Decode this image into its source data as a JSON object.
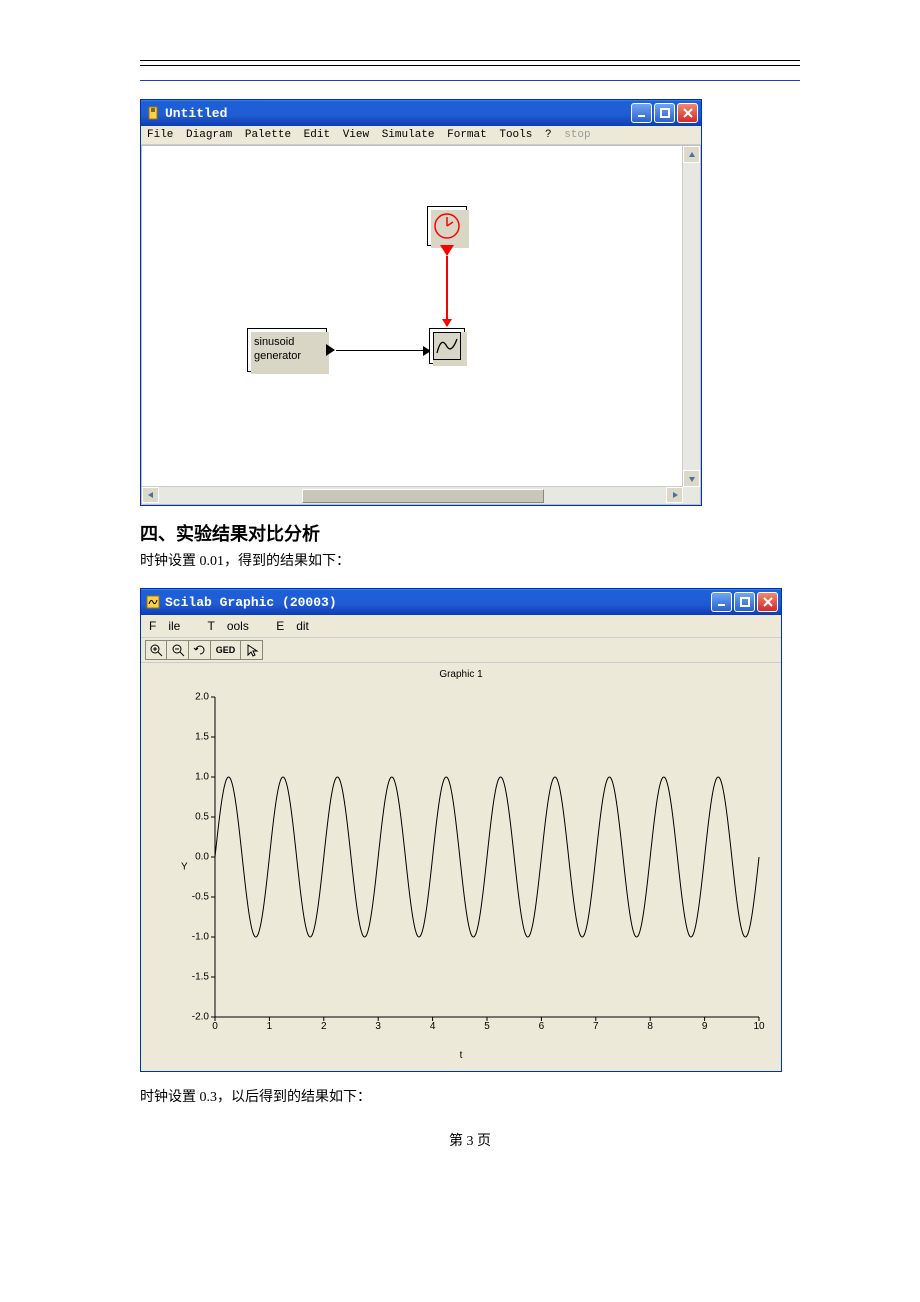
{
  "doc": {
    "section_title": "四、实验结果对比分析",
    "text1": "时钟设置  0.01，得到的结果如下：",
    "text2": "时钟设置 0.3，以后得到的结果如下：",
    "page_num": "第 3 页"
  },
  "win1": {
    "title": "Untitled",
    "menu": [
      "File",
      "Diagram",
      "Palette",
      "Edit",
      "View",
      "Simulate",
      "Format",
      "Tools",
      "?",
      "stop"
    ],
    "block_gen_l1": "sinusoid",
    "block_gen_l2": "generator"
  },
  "win2": {
    "title": "Scilab Graphic (20003)",
    "menu_file": "File",
    "menu_tools": "Tools",
    "menu_edit": "Edit",
    "tool_ged": "GED",
    "plot_title": "Graphic 1"
  },
  "chart_data": {
    "type": "line",
    "title": "Graphic 1",
    "xlabel": "t",
    "ylabel": "Y",
    "xlim": [
      0,
      10
    ],
    "ylim": [
      -2.0,
      2.0
    ],
    "xticks": [
      0,
      1,
      2,
      3,
      4,
      5,
      6,
      7,
      8,
      9,
      10
    ],
    "yticks": [
      2.0,
      1.5,
      1.0,
      0.5,
      0.0,
      -0.5,
      -1.0,
      -1.5,
      -2.0
    ],
    "series": [
      {
        "name": "sin",
        "amplitude": 1.0,
        "period": 1.0,
        "phase": 0,
        "t_range": [
          0,
          10
        ],
        "dt": 0.01,
        "note": "y = sin(2*pi*t); values oscillate between -1 and 1 with ~10 full periods over [0,10]"
      }
    ]
  }
}
